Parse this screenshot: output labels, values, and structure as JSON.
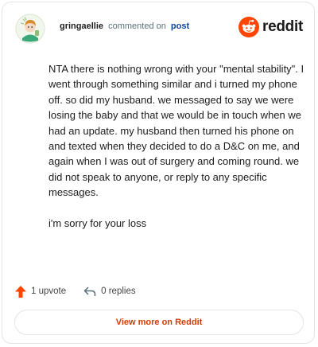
{
  "header": {
    "username": "gringaellie",
    "action_text": "commented on",
    "post_link": "post",
    "logo_text": "reddit"
  },
  "comment": {
    "paragraphs": [
      "NTA there is nothing wrong with your \"mental stability\". I went through something similar and i turned my phone off. so did my husband. we messaged to say we were losing the baby and that we would be in touch when we had an update. my husband then turned his phone on and texted when they decided to do a D&C on me, and again when I was out of surgery and coming round. we did not speak to anyone, or reply to any specific messages.",
      "i'm sorry for your loss"
    ]
  },
  "actions": {
    "upvote_label": "1 upvote",
    "replies_label": "0 replies"
  },
  "footer": {
    "view_more_label": "View more on Reddit"
  },
  "colors": {
    "brand": "#ff4500",
    "link": "#0a449b",
    "view_more": "#d93a00"
  }
}
